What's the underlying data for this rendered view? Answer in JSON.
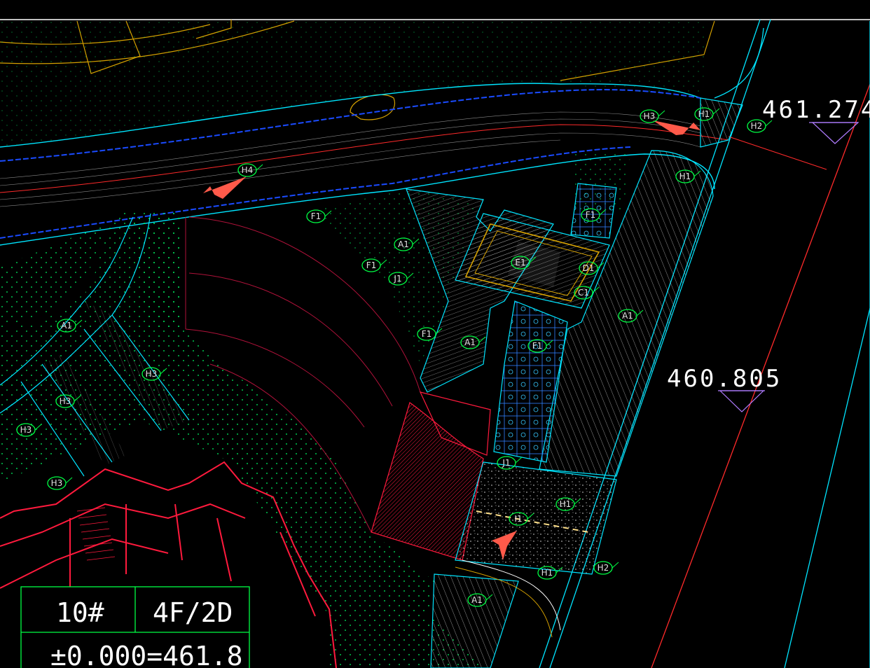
{
  "drawing": {
    "background": "#000000",
    "colors": {
      "road_edge": "#00e5ff",
      "centerline": "#ff2a2a",
      "planting_dots": "#00ff66",
      "paving_lines": "#ffffff",
      "building": "#ff1a3d",
      "callout": "#00ff44",
      "arrow": "#ff5a4a",
      "boundary": "#d4a000"
    }
  },
  "elevations": [
    {
      "id": "elev-top",
      "value": "461.274"
    },
    {
      "id": "elev-mid",
      "value": "460.805"
    }
  ],
  "callouts": [
    {
      "id": "h4",
      "label": "H4"
    },
    {
      "id": "h3-top",
      "label": "H3"
    },
    {
      "id": "h1-top",
      "label": "H1"
    },
    {
      "id": "h2-top",
      "label": "H2"
    },
    {
      "id": "h1-right",
      "label": "H1"
    },
    {
      "id": "f1-a",
      "label": "F1"
    },
    {
      "id": "a1-a",
      "label": "A1"
    },
    {
      "id": "f1-b",
      "label": "F1"
    },
    {
      "id": "j1-a",
      "label": "J1"
    },
    {
      "id": "f1-c",
      "label": "F1"
    },
    {
      "id": "a1-b",
      "label": "A1"
    },
    {
      "id": "e1",
      "label": "E1"
    },
    {
      "id": "d1",
      "label": "D1"
    },
    {
      "id": "c1",
      "label": "C1"
    },
    {
      "id": "a1-c",
      "label": "A1"
    },
    {
      "id": "f1-d",
      "label": "F1"
    },
    {
      "id": "f1-e",
      "label": "F1"
    },
    {
      "id": "a1-left",
      "label": "A1"
    },
    {
      "id": "h3-a",
      "label": "H3"
    },
    {
      "id": "h3-b",
      "label": "H3"
    },
    {
      "id": "h3-c",
      "label": "H3"
    },
    {
      "id": "h3-d",
      "label": "H3"
    },
    {
      "id": "j1-b",
      "label": "J1"
    },
    {
      "id": "h1-low",
      "label": "H1"
    },
    {
      "id": "i1",
      "label": "I1"
    },
    {
      "id": "h1-bottom",
      "label": "H1"
    },
    {
      "id": "h2-bottom",
      "label": "H2"
    },
    {
      "id": "a1-bottom",
      "label": "A1"
    }
  ],
  "title_block": {
    "building_no": "10#",
    "floors": "4F/2D",
    "elevation": "±0.000=461.8"
  }
}
